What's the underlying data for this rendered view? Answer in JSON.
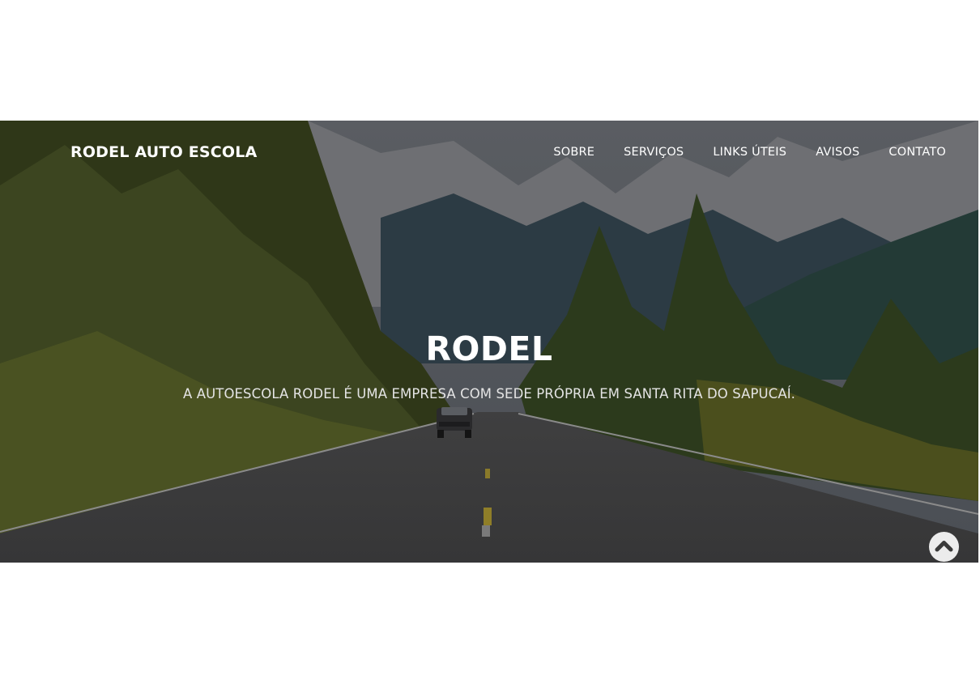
{
  "header": {
    "brand": "RODEL AUTO ESCOLA",
    "nav": [
      {
        "label": "SOBRE"
      },
      {
        "label": "SERVIÇOS"
      },
      {
        "label": "LINKS ÚTEIS"
      },
      {
        "label": "AVISOS"
      },
      {
        "label": "CONTATO"
      }
    ]
  },
  "hero": {
    "title": "RODEL",
    "subtitle": "A AUTOESCOLA RODEL É UMA EMPRESA COM SEDE PRÓPRIA EM SANTA RITA DO SAPUCAÍ.",
    "background": "mountain-road-photo"
  },
  "scroll_top": {
    "icon": "chevron-up-icon"
  },
  "colors": {
    "page_background": "#ffffff",
    "text": "#ffffff",
    "overlay": "#000000"
  }
}
